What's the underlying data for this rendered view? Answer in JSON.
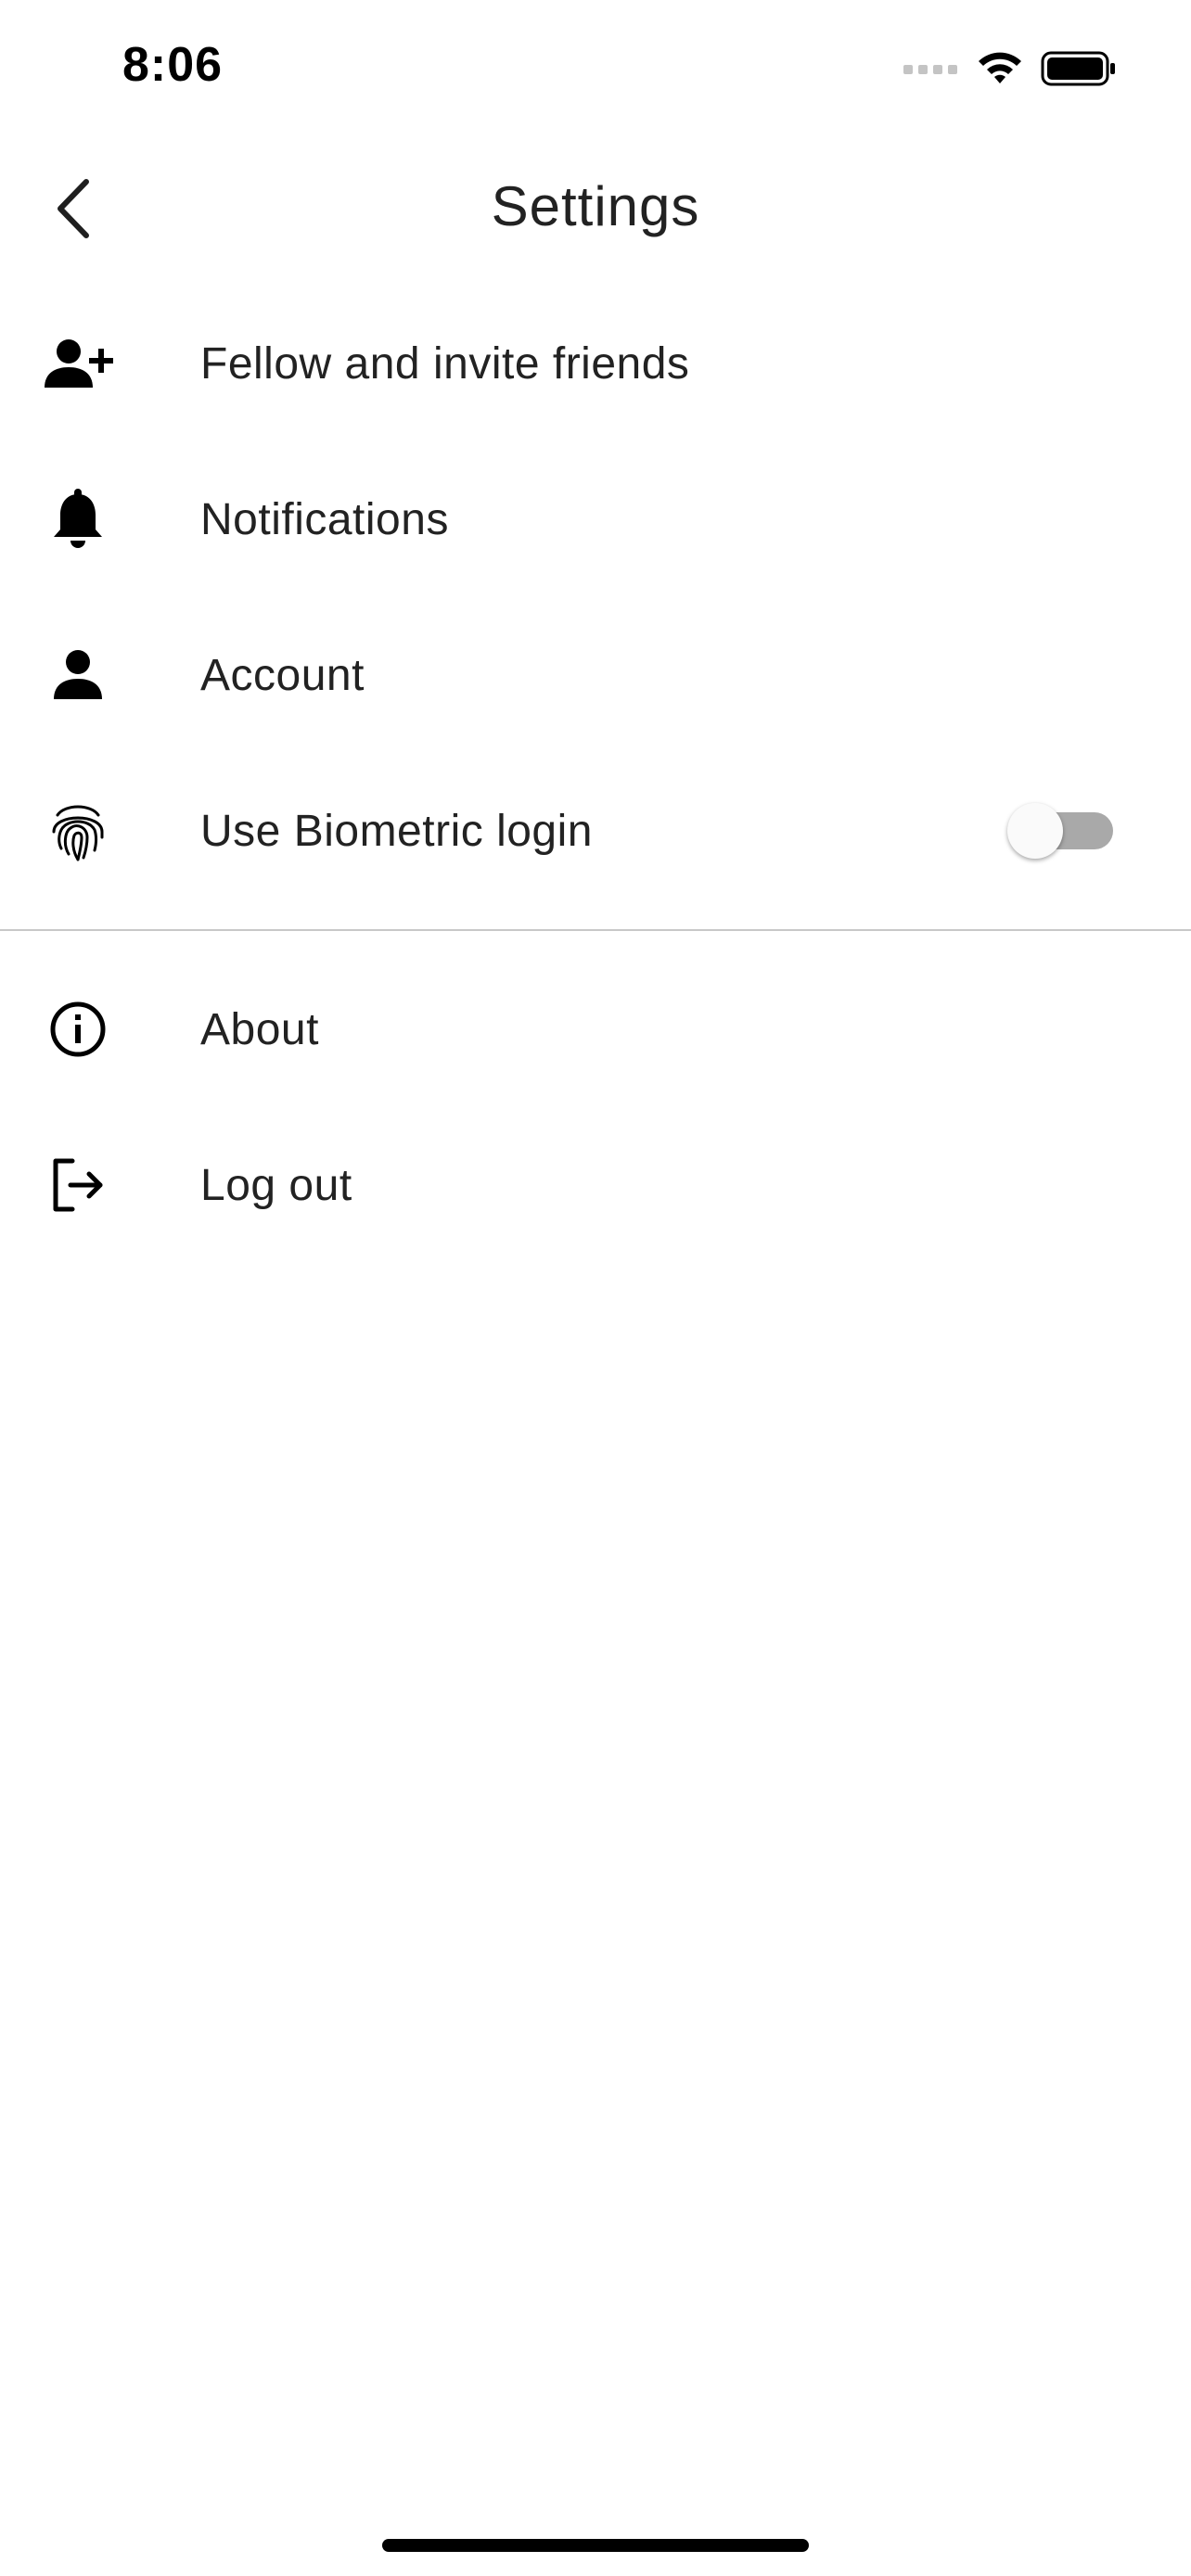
{
  "status_bar": {
    "time": "8:06",
    "icons": [
      "cellular-signal-icon",
      "wifi-icon",
      "battery-icon"
    ]
  },
  "header": {
    "title": "Settings",
    "back_icon": "chevron-left-icon"
  },
  "menu": {
    "items": [
      {
        "label": "Fellow and invite friends",
        "icon": "add-person-icon"
      },
      {
        "label": "Notifications",
        "icon": "bell-icon"
      },
      {
        "label": "Account",
        "icon": "person-icon"
      },
      {
        "label": "Use Biometric login",
        "icon": "fingerprint-icon",
        "toggle_on": false
      }
    ],
    "secondary_items": [
      {
        "label": "About",
        "icon": "info-icon"
      },
      {
        "label": "Log out",
        "icon": "logout-icon"
      }
    ]
  },
  "colors": {
    "background": "#ffffff",
    "text": "#222222",
    "divider": "#c8c8c8",
    "toggle_track_off": "#a9a9a9",
    "toggle_thumb": "#fafafa"
  }
}
